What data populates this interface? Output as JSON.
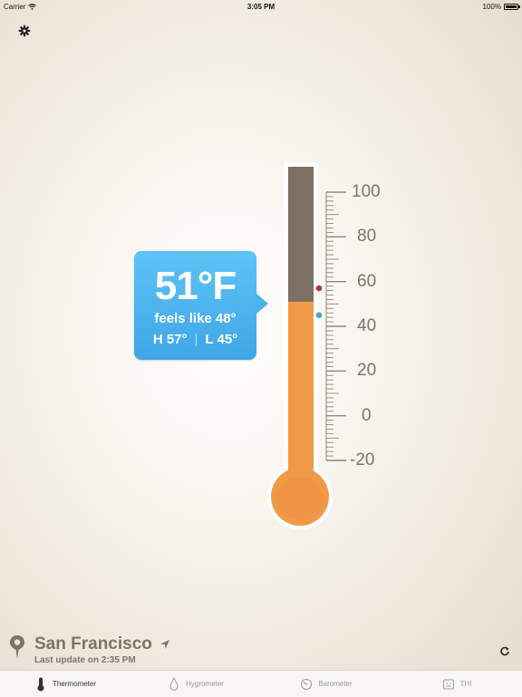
{
  "status_bar": {
    "carrier": "Carrier",
    "time": "3:05 PM",
    "battery": "100%"
  },
  "settings": {
    "icon": "gear-icon"
  },
  "reading": {
    "temperature": "51°F",
    "feels_like": "feels like 48°",
    "high": "H 57°",
    "low": "L 45°",
    "separator": "|"
  },
  "thermometer": {
    "scale_labels": [
      "100",
      "80",
      "60",
      "40",
      "20",
      "0",
      "-20"
    ],
    "fill_level_f": 51,
    "high_marker_f": 57,
    "low_marker_f": 45,
    "range_f": [
      -20,
      100
    ],
    "colors": {
      "mercury": "#f09a47",
      "empty": "#7d6f63",
      "high": "#b8323a",
      "low": "#3aa8c7",
      "bubble": "#4fb4ee"
    }
  },
  "location": {
    "city": "San Francisco",
    "last_update": "Last update on 2:35 PM"
  },
  "tabs": [
    {
      "label": "Thermometer",
      "icon": "thermometer-icon",
      "active": true
    },
    {
      "label": "Hygrometer",
      "icon": "droplet-icon",
      "active": false
    },
    {
      "label": "Barometer",
      "icon": "gauge-icon",
      "active": false
    },
    {
      "label": "THI",
      "icon": "thi-icon",
      "active": false
    }
  ]
}
